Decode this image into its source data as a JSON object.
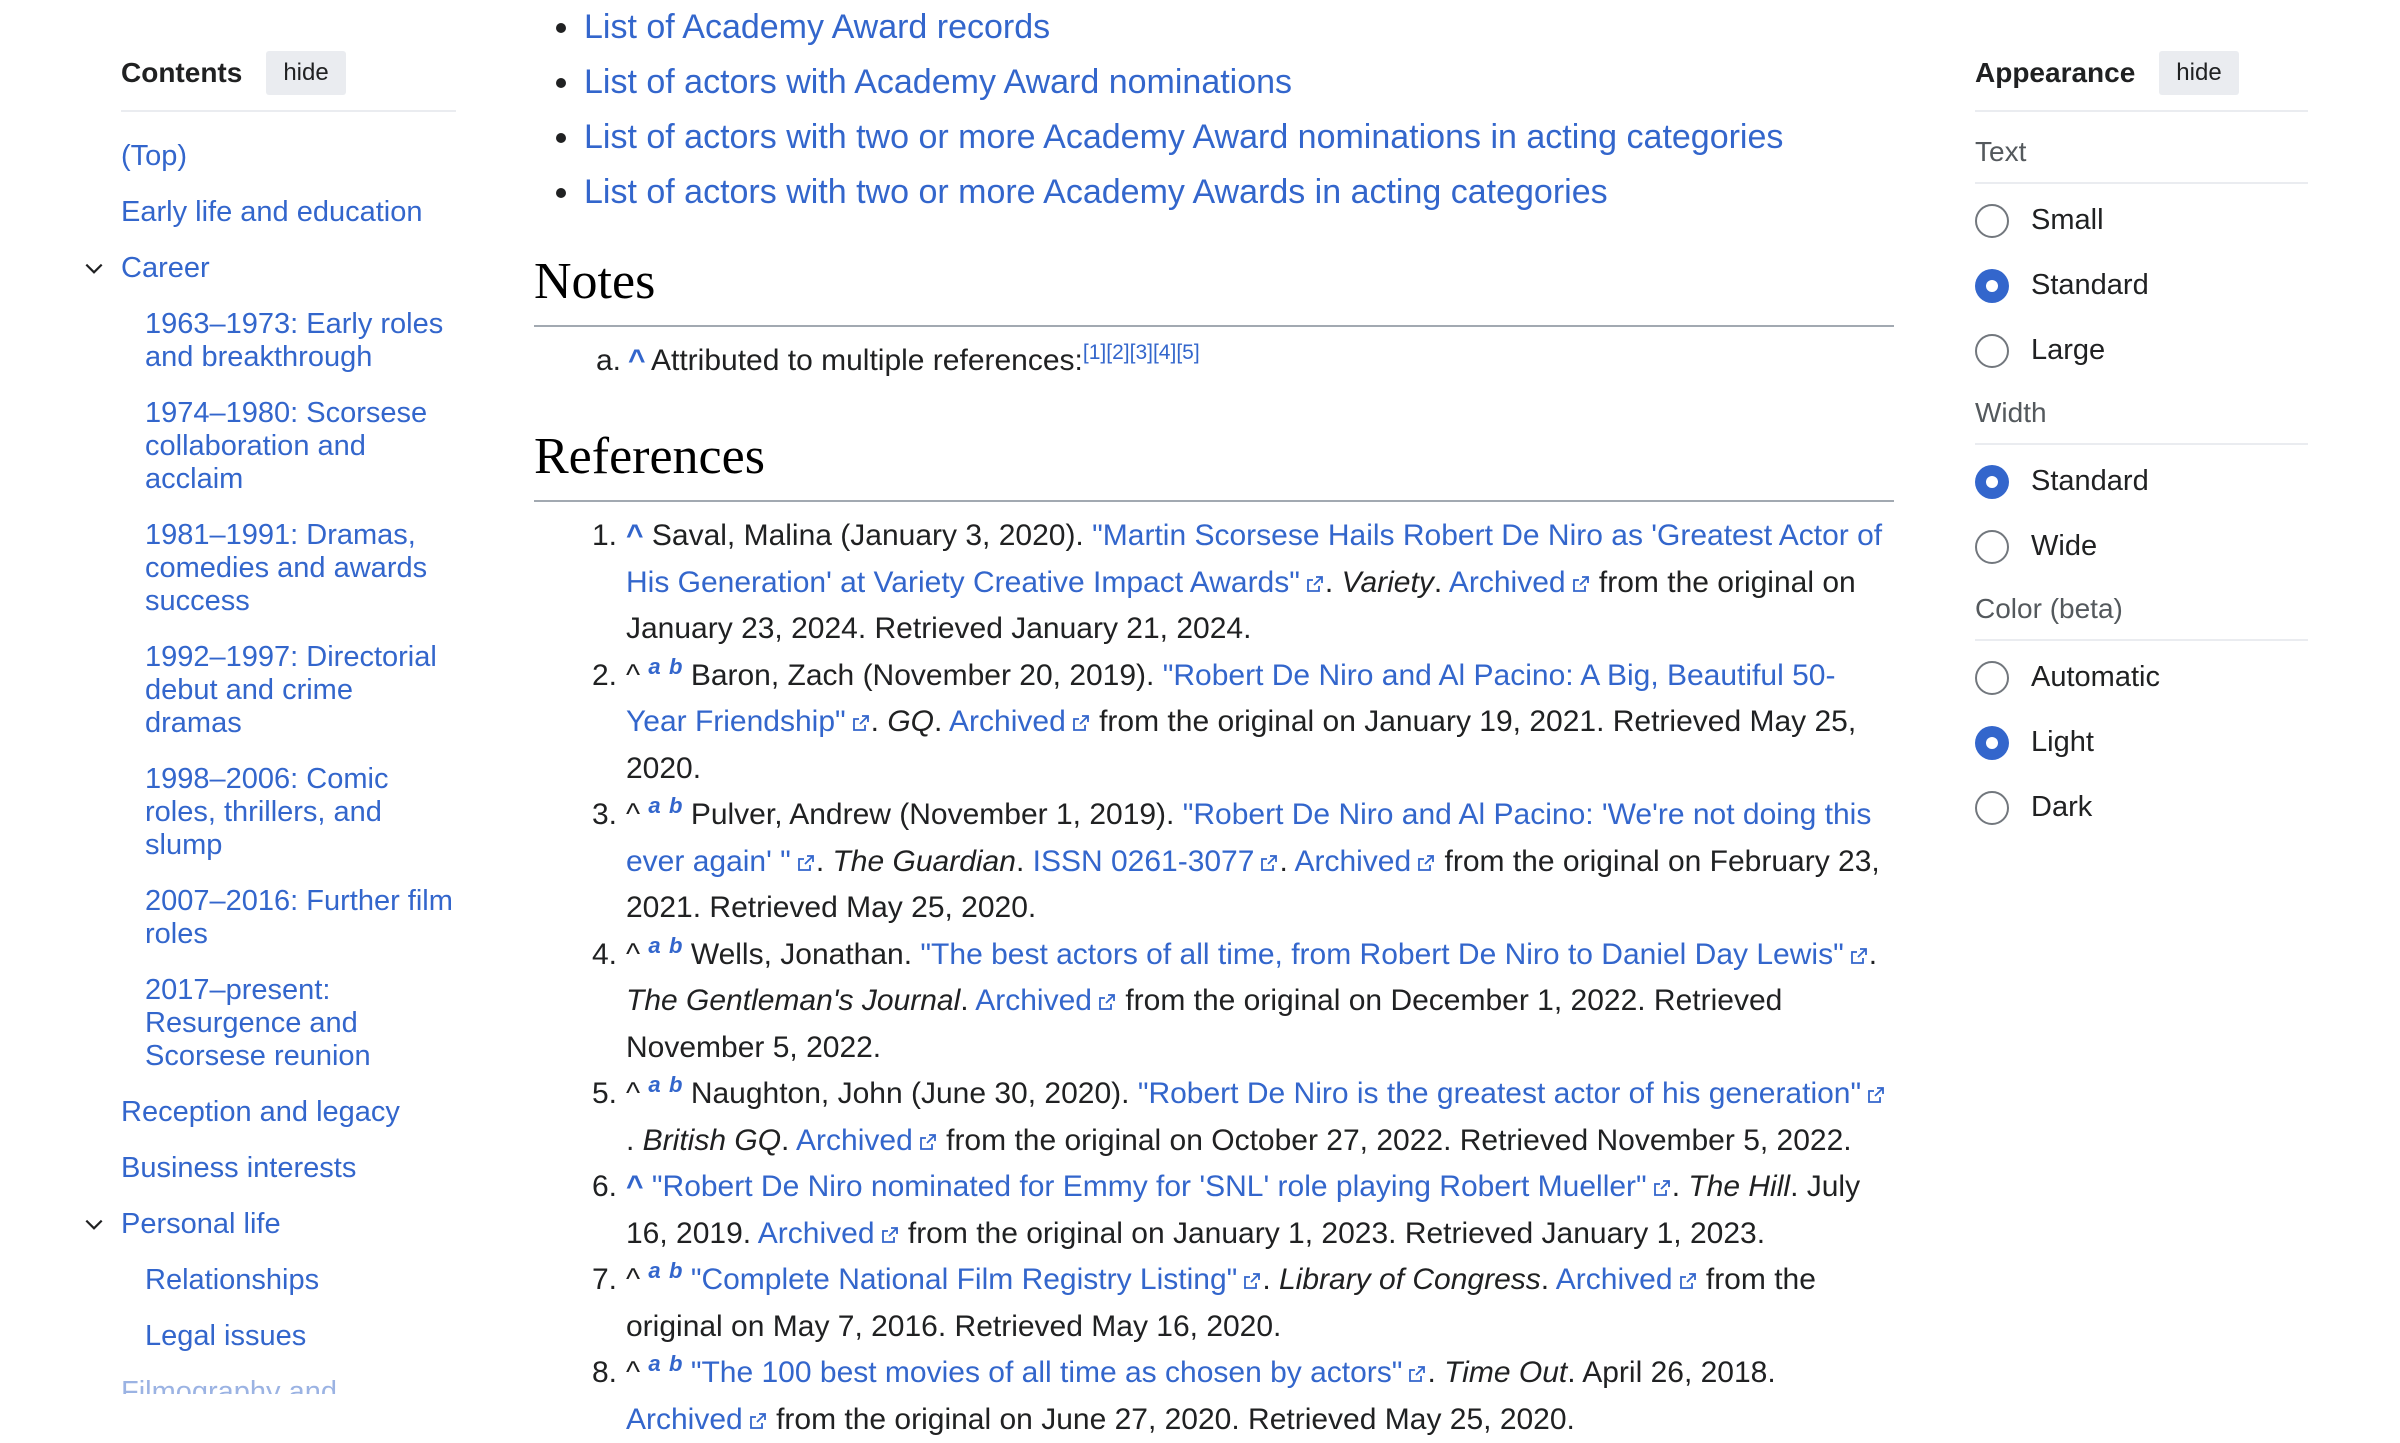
{
  "toc": {
    "title": "Contents",
    "hide_label": "hide",
    "items": [
      {
        "label": "(Top)"
      },
      {
        "label": "Early life and education"
      },
      {
        "label": "Career"
      },
      {
        "label": "1963–1973: Early roles and breakthrough"
      },
      {
        "label": "1974–1980: Scorsese collaboration and acclaim"
      },
      {
        "label": "1981–1991: Dramas, comedies and awards success"
      },
      {
        "label": "1992–1997: Directorial debut and crime dramas"
      },
      {
        "label": "1998–2006: Comic roles, thrillers, and slump"
      },
      {
        "label": "2007–2016: Further film roles"
      },
      {
        "label": "2017–present: Resurgence and Scorsese reunion"
      },
      {
        "label": "Reception and legacy"
      },
      {
        "label": "Business interests"
      },
      {
        "label": "Personal life"
      },
      {
        "label": "Relationships"
      },
      {
        "label": "Legal issues"
      },
      {
        "label": "Filmography and"
      }
    ]
  },
  "see_also": [
    "List of Academy Award records",
    "List of actors with Academy Award nominations",
    "List of actors with two or more Academy Award nominations in acting categories",
    "List of actors with two or more Academy Awards in acting categories"
  ],
  "notes": {
    "heading": "Notes",
    "items": [
      {
        "marker": "a.",
        "caret": "^",
        "text": "Attributed to multiple references:",
        "refs": [
          "[1]",
          "[2]",
          "[3]",
          "[4]",
          "[5]"
        ]
      }
    ]
  },
  "references": {
    "heading": "References",
    "items": [
      {
        "num": "1.",
        "caret": "^",
        "backlinks": [],
        "author": "Saval, Malina (January 3, 2020).",
        "title": "\"Martin Scorsese Hails Robert De Niro as 'Greatest Actor of His Generation' at Variety Creative Impact Awards\"",
        "pre_work": ".",
        "work": "Variety",
        "post_work": ".",
        "issn": "",
        "archived": "Archived",
        "tail": "from the original on January 23, 2024. Retrieved January 21, 2024."
      },
      {
        "num": "2.",
        "caret": "^",
        "backlinks": [
          "a",
          "b"
        ],
        "author": "Baron, Zach (November 20, 2019).",
        "title": "\"Robert De Niro and Al Pacino: A Big, Beautiful 50-Year Friendship\"",
        "pre_work": ".",
        "work": "GQ",
        "post_work": ".",
        "issn": "",
        "archived": "Archived",
        "tail": "from the original on January 19, 2021. Retrieved May 25, 2020."
      },
      {
        "num": "3.",
        "caret": "^",
        "backlinks": [
          "a",
          "b"
        ],
        "author": "Pulver, Andrew (November 1, 2019).",
        "title": "\"Robert De Niro and Al Pacino: 'We're not doing this ever again' \"",
        "pre_work": ".",
        "work": "The Guardian",
        "post_work": ".",
        "issn": "ISSN 0261-3077",
        "archived": "Archived",
        "tail": "from the original on February 23, 2021. Retrieved May 25, 2020."
      },
      {
        "num": "4.",
        "caret": "^",
        "backlinks": [
          "a",
          "b"
        ],
        "author": "Wells, Jonathan.",
        "title": "\"The best actors of all time, from Robert De Niro to Daniel Day Lewis\"",
        "pre_work": ".",
        "work": "The Gentleman's Journal",
        "post_work": ".",
        "issn": "",
        "archived": "Archived",
        "tail": "from the original on December 1, 2022. Retrieved November 5, 2022."
      },
      {
        "num": "5.",
        "caret": "^",
        "backlinks": [
          "a",
          "b"
        ],
        "author": "Naughton, John (June 30, 2020).",
        "title": "\"Robert De Niro is the greatest actor of his generation\"",
        "pre_work": ".",
        "work": "British GQ",
        "post_work": ".",
        "issn": "",
        "archived": "Archived",
        "tail": "from the original on October 27, 2022. Retrieved November 5, 2022."
      },
      {
        "num": "6.",
        "caret": "^",
        "backlinks": [],
        "author": "",
        "title": "\"Robert De Niro nominated for Emmy for 'SNL' role playing Robert Mueller\"",
        "pre_work": ".",
        "work": "The Hill",
        "post_work": ". July 16, 2019.",
        "issn": "",
        "archived": "Archived",
        "tail": "from the original on January 1, 2023. Retrieved January 1, 2023."
      },
      {
        "num": "7.",
        "caret": "^",
        "backlinks": [
          "a",
          "b"
        ],
        "author": "",
        "title": "\"Complete National Film Registry Listing\"",
        "pre_work": ".",
        "work": "Library of Congress",
        "post_work": ".",
        "issn": "",
        "archived": "Archived",
        "tail": "from the original on May 7, 2016. Retrieved May 16, 2020."
      },
      {
        "num": "8.",
        "caret": "^",
        "backlinks": [
          "a",
          "b"
        ],
        "author": "",
        "title": "\"The 100 best movies of all time as chosen by actors\"",
        "pre_work": ".",
        "work": "Time Out",
        "post_work": ". April 26, 2018.",
        "issn": "",
        "archived": "Archived",
        "tail": "from the original on June 27, 2020. Retrieved May 25, 2020."
      }
    ]
  },
  "appearance": {
    "title": "Appearance",
    "hide_label": "hide",
    "sections": [
      {
        "label": "Text",
        "options": [
          {
            "label": "Small",
            "selected": false
          },
          {
            "label": "Standard",
            "selected": true
          },
          {
            "label": "Large",
            "selected": false
          }
        ]
      },
      {
        "label": "Width",
        "options": [
          {
            "label": "Standard",
            "selected": true
          },
          {
            "label": "Wide",
            "selected": false
          }
        ]
      },
      {
        "label": "Color (beta)",
        "options": [
          {
            "label": "Automatic",
            "selected": false
          },
          {
            "label": "Light",
            "selected": true
          },
          {
            "label": "Dark",
            "selected": false
          }
        ]
      }
    ],
    "accent_color": "#3366cc"
  }
}
